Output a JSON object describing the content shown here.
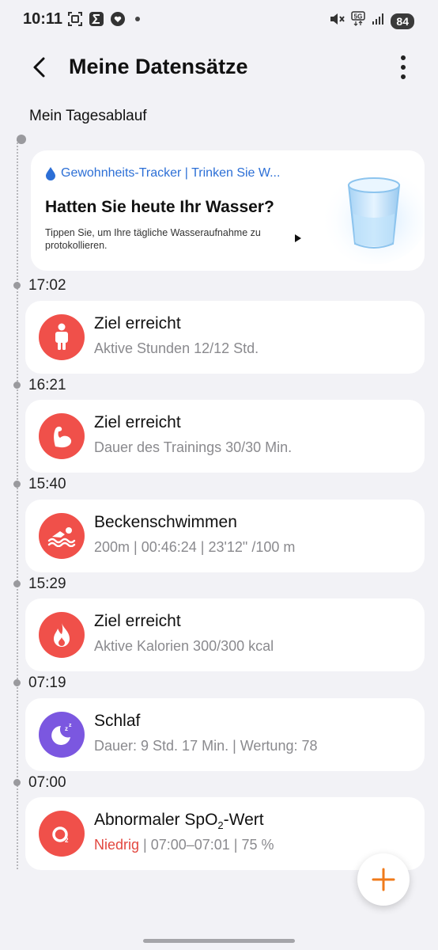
{
  "status_bar": {
    "time": "10:11",
    "battery": "84",
    "icons": [
      "screenshot-icon",
      "sigma-app-icon",
      "health-heart-icon",
      "mute-icon",
      "5g-icon",
      "signal-icon"
    ]
  },
  "header": {
    "title": "Meine Datensätze"
  },
  "section": {
    "label": "Mein Tagesablauf"
  },
  "habit_card": {
    "tag": "Gewohnheits-Tracker | Trinken Sie W...",
    "title": "Hatten Sie heute Ihr Wasser?",
    "description": "Tippen Sie, um Ihre tägliche Wasseraufnahme zu protokollieren."
  },
  "entries": [
    {
      "time": "17:02",
      "title": "Ziel erreicht",
      "subtitle": "Aktive Stunden 12/12 Std.",
      "icon": "person-standing-icon",
      "color": "#f0504a"
    },
    {
      "time": "16:21",
      "title": "Ziel erreicht",
      "subtitle": "Dauer des Trainings 30/30 Min.",
      "icon": "bicep-arm-icon",
      "color": "#f0504a"
    },
    {
      "time": "15:40",
      "title": "Beckenschwimmen",
      "subtitle": "200m | 00:46:24 | 23'12\" /100 m",
      "icon": "swimmer-icon",
      "color": "#f0504a"
    },
    {
      "time": "15:29",
      "title": "Ziel erreicht",
      "subtitle": "Aktive Kalorien 300/300 kcal",
      "icon": "flame-icon",
      "color": "#f0504a"
    },
    {
      "time": "07:19",
      "title": "Schlaf",
      "subtitle": "Dauer: 9 Std. 17 Min. | Wertung: 78",
      "icon": "moon-sleep-icon",
      "color": "#7b57e0"
    },
    {
      "time": "07:00",
      "title_prefix": "Abnormaler SpO",
      "title_sub": "2",
      "title_suffix": "-Wert",
      "subtitle_status": "Niedrig",
      "subtitle_rest": " | 07:00–07:01 | 75 %",
      "icon": "oxygen-icon",
      "color": "#f0504a"
    }
  ],
  "colors": {
    "accent_red": "#f0504a",
    "sleep_purple": "#7b57e0",
    "tag_blue": "#2c6fd6",
    "fab_plus": "#f07a1a"
  }
}
